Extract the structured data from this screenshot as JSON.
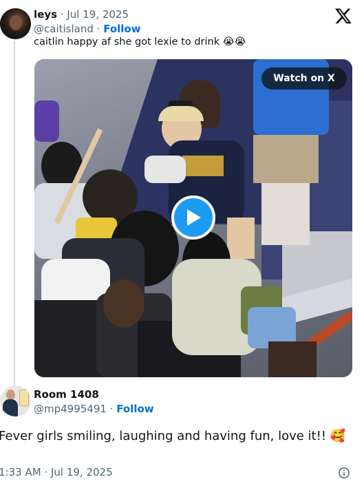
{
  "tweet": {
    "author_name": "leys",
    "date": "Jul 19, 2025",
    "handle": "@caitisland",
    "follow_label": "Follow",
    "text": "caitlin happy af she got lexie to drink 😭😭",
    "watch_label": "Watch on X"
  },
  "reply": {
    "author_name": "Room 1408",
    "handle": "@mp4995491",
    "follow_label": "Follow",
    "text": "Fever girls smiling,  laughing and having fun, love it!!  🥰",
    "timestamp": "1:33 AM · Jul 19, 2025"
  },
  "colors": {
    "link": "#006fd6",
    "play_button": "#1d9bf0",
    "muted_text": "#536471"
  },
  "icons": [
    "x-logo-icon",
    "play-icon",
    "info-icon"
  ]
}
